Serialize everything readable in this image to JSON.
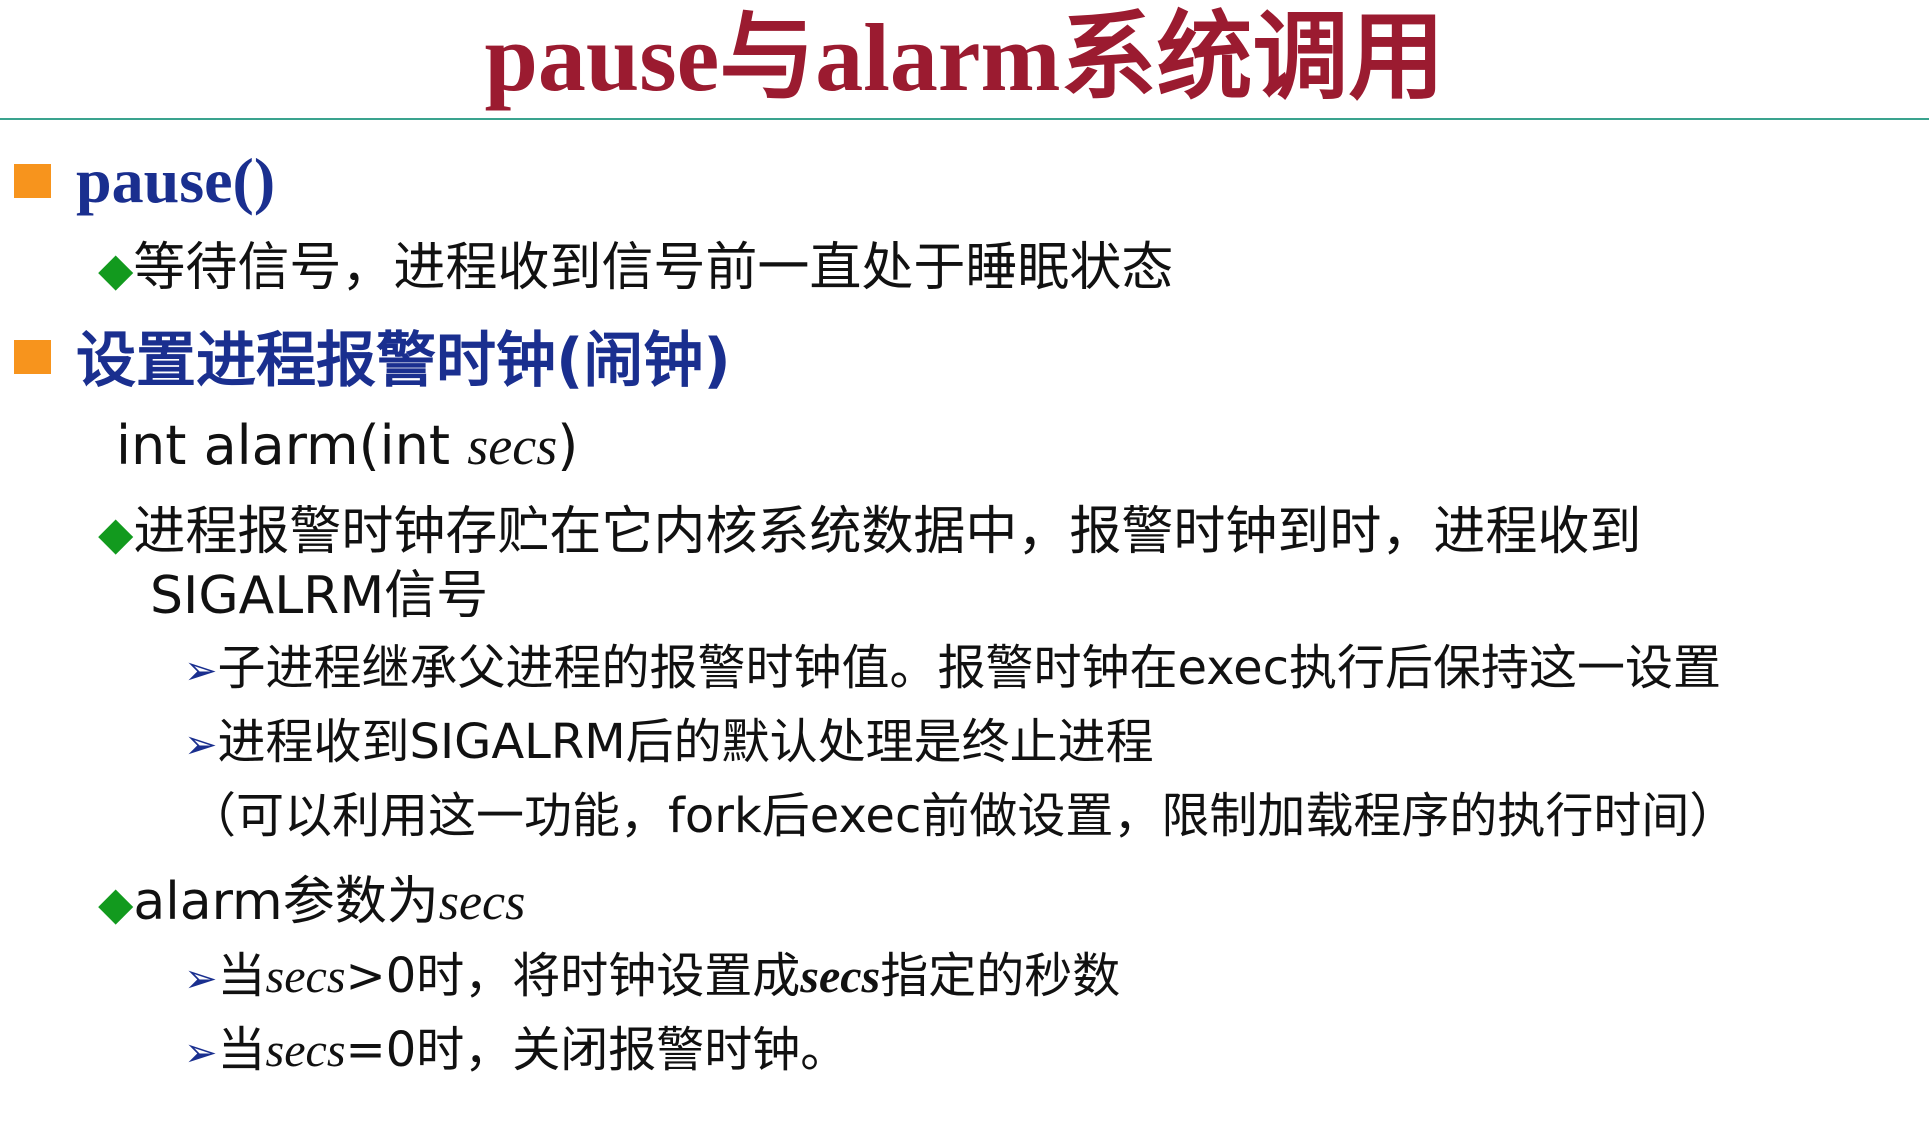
{
  "title": "pause与alarm系统调用",
  "sections": [
    {
      "heading": "pause()",
      "items": [
        {
          "text": "等待信号，进程收到信号前一直处于睡眠状态"
        }
      ]
    },
    {
      "heading": "设置进程报警时钟(闹钟)",
      "signature": {
        "prefix": "int alarm(int ",
        "param": "secs",
        "suffix": ")"
      },
      "items": [
        {
          "line1": "进程报警时钟存贮在它内核系统数据中，报警时钟到时，进程收到",
          "line2": "SIGALRM信号",
          "subitems": [
            "子进程继承父进程的报警时钟值。报警时钟在exec执行后保持这一设置",
            "进程收到SIGALRM后的默认处理是终止进程"
          ],
          "note": "（可以利用这一功能，fork后exec前做设置，限制加载程序的执行时间）"
        },
        {
          "prefix": "alarm参数为",
          "param": "secs",
          "subitems": [
            {
              "a": "当",
              "b": "secs",
              "c": ">0时，将时钟设置成",
              "d": "secs",
              "e": "指定的秒数"
            },
            {
              "a": "当",
              "b": "secs",
              "c": "=0时，关闭报警时钟。"
            }
          ]
        }
      ]
    }
  ],
  "icons": {
    "level1": "orange-square-bullet",
    "level2": "green-diamond-bullet",
    "level3": "blue-arrow-bullet"
  },
  "colors": {
    "title": "#9b1b30",
    "heading": "#1a2f8f",
    "rule": "#3aa38e",
    "square_bullet": "#f7941d",
    "diamond_bullet": "#129a1e",
    "arrow_bullet": "#1a2f8f"
  }
}
